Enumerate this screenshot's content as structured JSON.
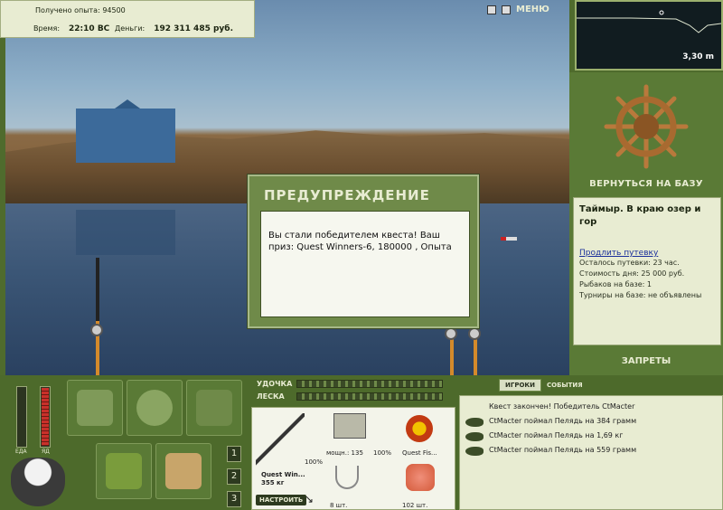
{
  "info": {
    "xp_line": "Получено опыта: 94500",
    "time_label": "Время:",
    "time_value": "22:10 ВС",
    "money_label": "Деньги:",
    "money_value": "192 311 485 руб."
  },
  "top": {
    "menu_label": "МЕНЮ",
    "icons": [
      "pause-icon",
      "sound-icon",
      "gear-icon"
    ]
  },
  "depth": {
    "value": "3,30 m"
  },
  "right": {
    "home_button": "ВЕРНУТЬСЯ НА БАЗУ",
    "base_title": "Таймыр. В краю озер и гор",
    "extend_link": "Продлить путевку",
    "rows": [
      "Осталось путевки: 23 час.",
      "Стоимость дня: 25 000 руб.",
      "Рыбаков на базе: 1",
      "Турниры на базе: не объявлены"
    ],
    "bans_button": "ЗАПРЕТЫ"
  },
  "dialog": {
    "title": "ПРЕДУПРЕЖДЕНИЕ",
    "message": "Вы стали победителем квеста! Ваш приз: Quest Winners-6, 180000 , Опыта"
  },
  "bottom": {
    "food_label": "ЕДА",
    "poison_label": "ЯД",
    "pages": [
      "1",
      "2",
      "3"
    ],
    "rod_label": "УДОЧКА",
    "line_label": "ЛЕСКА",
    "rod_name": "Quest Win...",
    "rod_weight": "355 кг",
    "rod_percent": "100%",
    "setup_button": "НАСТРОИТЬ",
    "reel_caption": "мощн.: 135",
    "reel_percent": "100%",
    "line_caption": "Quest Fis...",
    "hook_count": "8 шт.",
    "bait_count": "102 шт."
  },
  "events": {
    "tabs": [
      "ИГРОКИ",
      "СОБЫТИЯ"
    ],
    "items": [
      "Квест закончен! Победитель CtMacter",
      "CtMacter поймал Пелядь на 384 грамм",
      "CtMacter поймал Пелядь на 1,69 кг",
      "CtMacter поймал Пелядь на 559 грамм"
    ]
  },
  "colors": {
    "panel": "#5a7a36",
    "cream": "#e8ecd2",
    "dialog": "#6f8a49",
    "link": "#1a2f9b"
  }
}
